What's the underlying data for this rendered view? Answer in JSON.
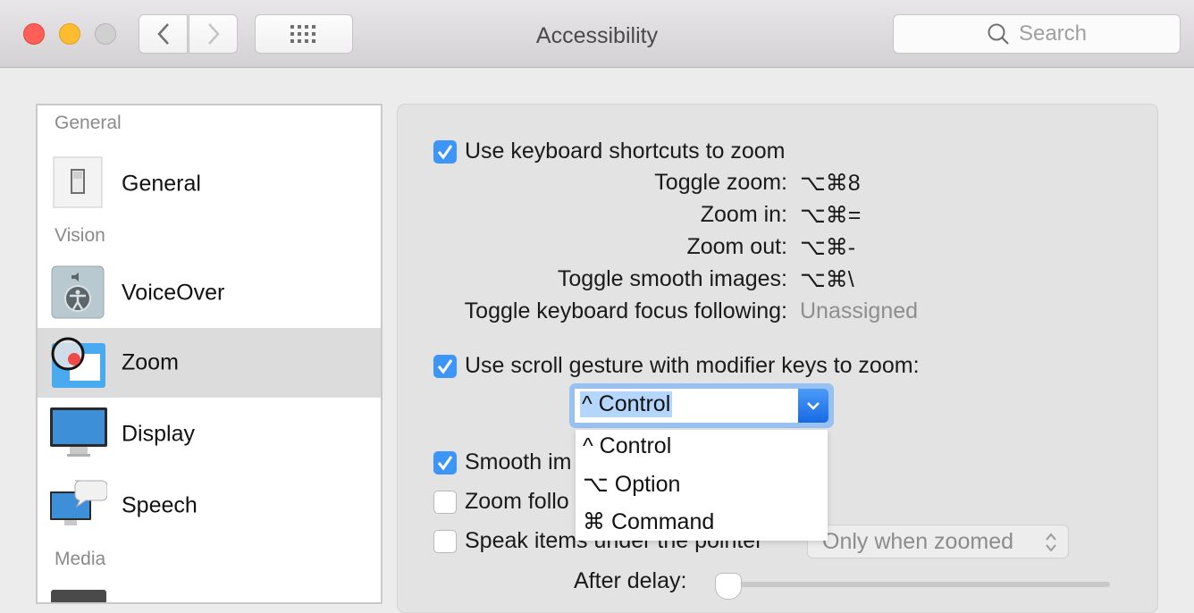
{
  "window": {
    "title": "Accessibility",
    "search_placeholder": "Search",
    "buttons": {
      "back": "back",
      "forward": "forward",
      "show_all": "show-all-grid"
    }
  },
  "sidebar": {
    "sections": [
      {
        "label": "General",
        "items": [
          {
            "label": "General",
            "icon": "general-switch-icon"
          }
        ]
      },
      {
        "label": "Vision",
        "items": [
          {
            "label": "VoiceOver",
            "icon": "voiceover-icon"
          },
          {
            "label": "Zoom",
            "icon": "zoom-magnifier-icon",
            "selected": true
          },
          {
            "label": "Display",
            "icon": "display-monitor-icon"
          },
          {
            "label": "Speech",
            "icon": "speech-bubble-icon"
          }
        ]
      },
      {
        "label": "Media",
        "items": []
      }
    ]
  },
  "panel": {
    "keyboard_shortcuts": {
      "label": "Use keyboard shortcuts to zoom",
      "checked": true,
      "shortcuts": [
        {
          "label": "Toggle zoom:",
          "value": "⌥⌘8"
        },
        {
          "label": "Zoom in:",
          "value": "⌥⌘="
        },
        {
          "label": "Zoom out:",
          "value": "⌥⌘-"
        },
        {
          "label": "Toggle smooth images:",
          "value": "⌥⌘\\"
        },
        {
          "label": "Toggle keyboard focus following:",
          "value": "Unassigned"
        }
      ]
    },
    "scroll_gesture": {
      "label": "Use scroll gesture with modifier keys to zoom:",
      "checked": true,
      "selected": "^ Control",
      "options": [
        "^ Control",
        "⌥ Option",
        "⌘ Command"
      ]
    },
    "smooth_images": {
      "label": "Smooth images",
      "visible_label": "Smooth im",
      "checked": true
    },
    "zoom_follows": {
      "label": "Zoom follows keyboard focus",
      "visible_label": "Zoom follo",
      "checked": false
    },
    "speak_items": {
      "label": "Speak items under the pointer",
      "checked": false,
      "popup_value": "Only when zoomed"
    },
    "after_delay": {
      "label": "After delay:",
      "value_fraction": 0.0
    }
  }
}
